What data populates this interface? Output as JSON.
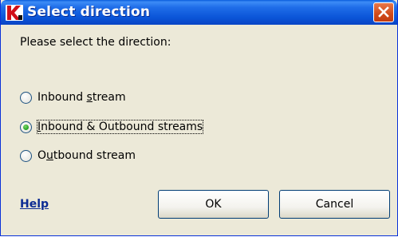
{
  "window": {
    "title": "Select direction",
    "close_glyph": "✕"
  },
  "prompt": "Please select the direction:",
  "options": [
    {
      "pre": "Inbound ",
      "accel": "s",
      "post": "tream",
      "checked": false
    },
    {
      "pre": "",
      "accel": "I",
      "post": "nbound & Outbound streams",
      "checked": true
    },
    {
      "pre": "O",
      "accel": "u",
      "post": "tbound stream",
      "checked": false
    }
  ],
  "help_label": "Help",
  "buttons": {
    "ok": "OK",
    "cancel": "Cancel"
  },
  "colors": {
    "titlebar": "#0a5cdc",
    "dialog_bg": "#ece9d8",
    "link": "#0b2a93",
    "close": "#d04a1a",
    "radio_dot": "#21a121"
  },
  "icons": {
    "app": "kaspersky-k-icon",
    "close": "close-icon"
  }
}
